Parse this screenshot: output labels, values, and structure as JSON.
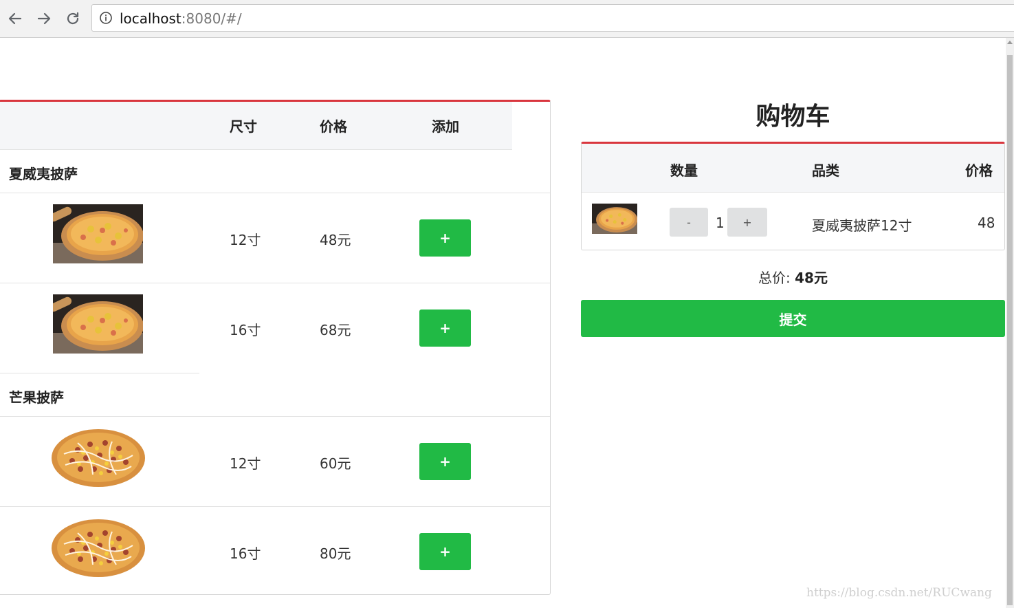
{
  "browser": {
    "url_host": "localhost",
    "url_rest": ":8080/#/"
  },
  "menu": {
    "headers": {
      "size": "尺寸",
      "price": "价格",
      "add": "添加"
    },
    "categories": [
      {
        "name": "夏威夷披萨",
        "items": [
          {
            "size": "12寸",
            "price": "48元",
            "add_label": "+"
          },
          {
            "size": "16寸",
            "price": "68元",
            "add_label": "+"
          }
        ]
      },
      {
        "name": "芒果披萨",
        "items": [
          {
            "size": "12寸",
            "price": "60元",
            "add_label": "+"
          },
          {
            "size": "16寸",
            "price": "80元",
            "add_label": "+"
          }
        ]
      }
    ]
  },
  "cart": {
    "title": "购物车",
    "headers": {
      "quantity": "数量",
      "category": "品类",
      "price": "价格"
    },
    "items": [
      {
        "minus_label": "-",
        "quantity": "1",
        "plus_label": "+",
        "category": "夏威夷披萨12寸",
        "price": "48"
      }
    ],
    "total_label": "总价:",
    "total_value": "48元",
    "submit_label": "提交"
  },
  "watermark": "https://blog.csdn.net/RUCwang",
  "colors": {
    "accent": "#d9363e",
    "button_green": "#21ba45"
  }
}
